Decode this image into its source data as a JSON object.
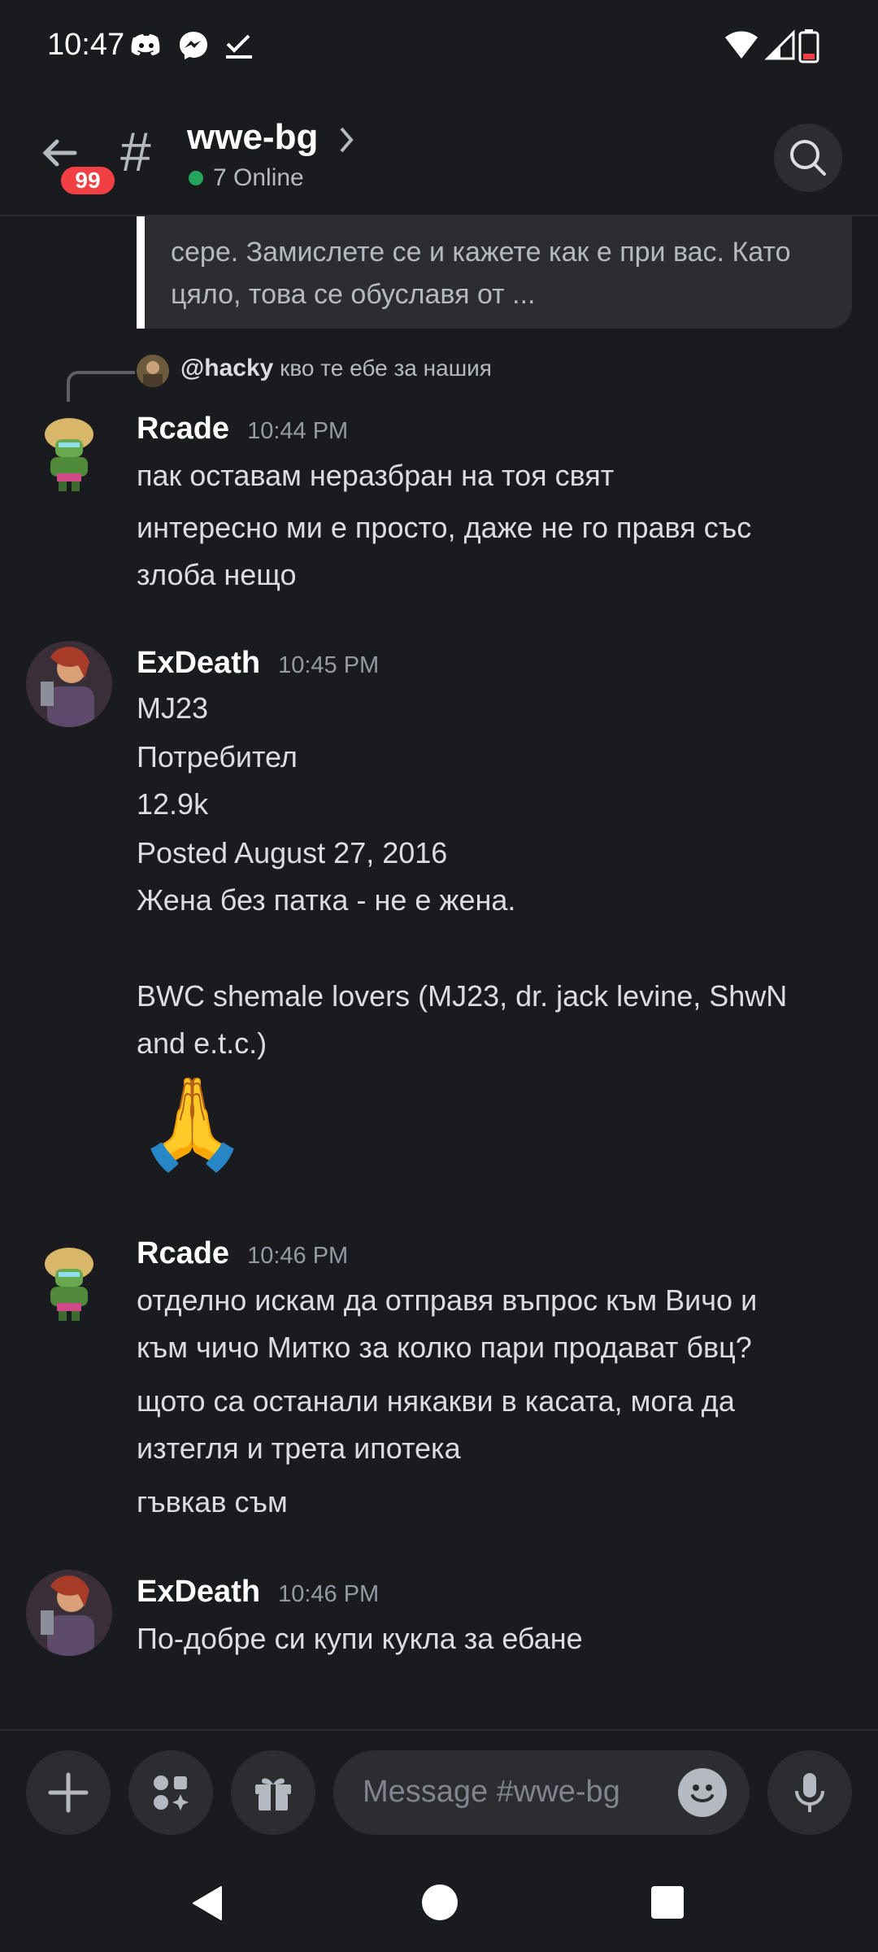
{
  "status_bar": {
    "time": "10:47",
    "icons": [
      "discord-icon",
      "messenger-icon",
      "check-icon",
      "wifi-icon",
      "signal-icon",
      "battery-icon"
    ]
  },
  "header": {
    "unread_badge": "99",
    "channel_name": "wwe-bg",
    "online_status": "7 Online"
  },
  "embed": {
    "line1": "сере. Замислете се и кажете как е при вас. Като",
    "line2": "цяло, това се обуславя от ..."
  },
  "messages": [
    {
      "reply_to_user": "@hacky",
      "reply_text": "кво те ебе за нашия",
      "username": "Rcade",
      "time": "10:44 PM",
      "lines": [
        "пак оставам неразбран на тоя свят",
        "интересно ми е просто, даже не го правя със",
        "злоба нещо"
      ]
    },
    {
      "username": "ExDeath",
      "time": "10:45 PM",
      "lines": [
        "MJ23",
        "Потребител",
        " 12.9k",
        "Posted August 27, 2016",
        "Жена без патка - не е жена.",
        "BWC shemale lovers (MJ23, dr. jack levine, ShwN",
        "and e.t.c.)"
      ],
      "emoji": "🙏"
    },
    {
      "username": "Rcade",
      "time": "10:46 PM",
      "lines": [
        "отделно искам да отправя въпрос към Вичо и",
        "към чичо Митко за колко пари продават бвц?",
        "щото са останали някакви в касата, мога да",
        "изтегля и трета ипотека",
        "гъвкав съм"
      ]
    },
    {
      "username": "ExDeath",
      "time": "10:46 PM",
      "lines": [
        "По-добре си купи кукла за ебане"
      ]
    }
  ],
  "composer": {
    "placeholder": "Message #wwe-bg"
  },
  "colors": {
    "background": "#1a1b1e",
    "surface": "#2b2d31",
    "badge_red": "#f23f43",
    "online_green": "#23a55a"
  }
}
